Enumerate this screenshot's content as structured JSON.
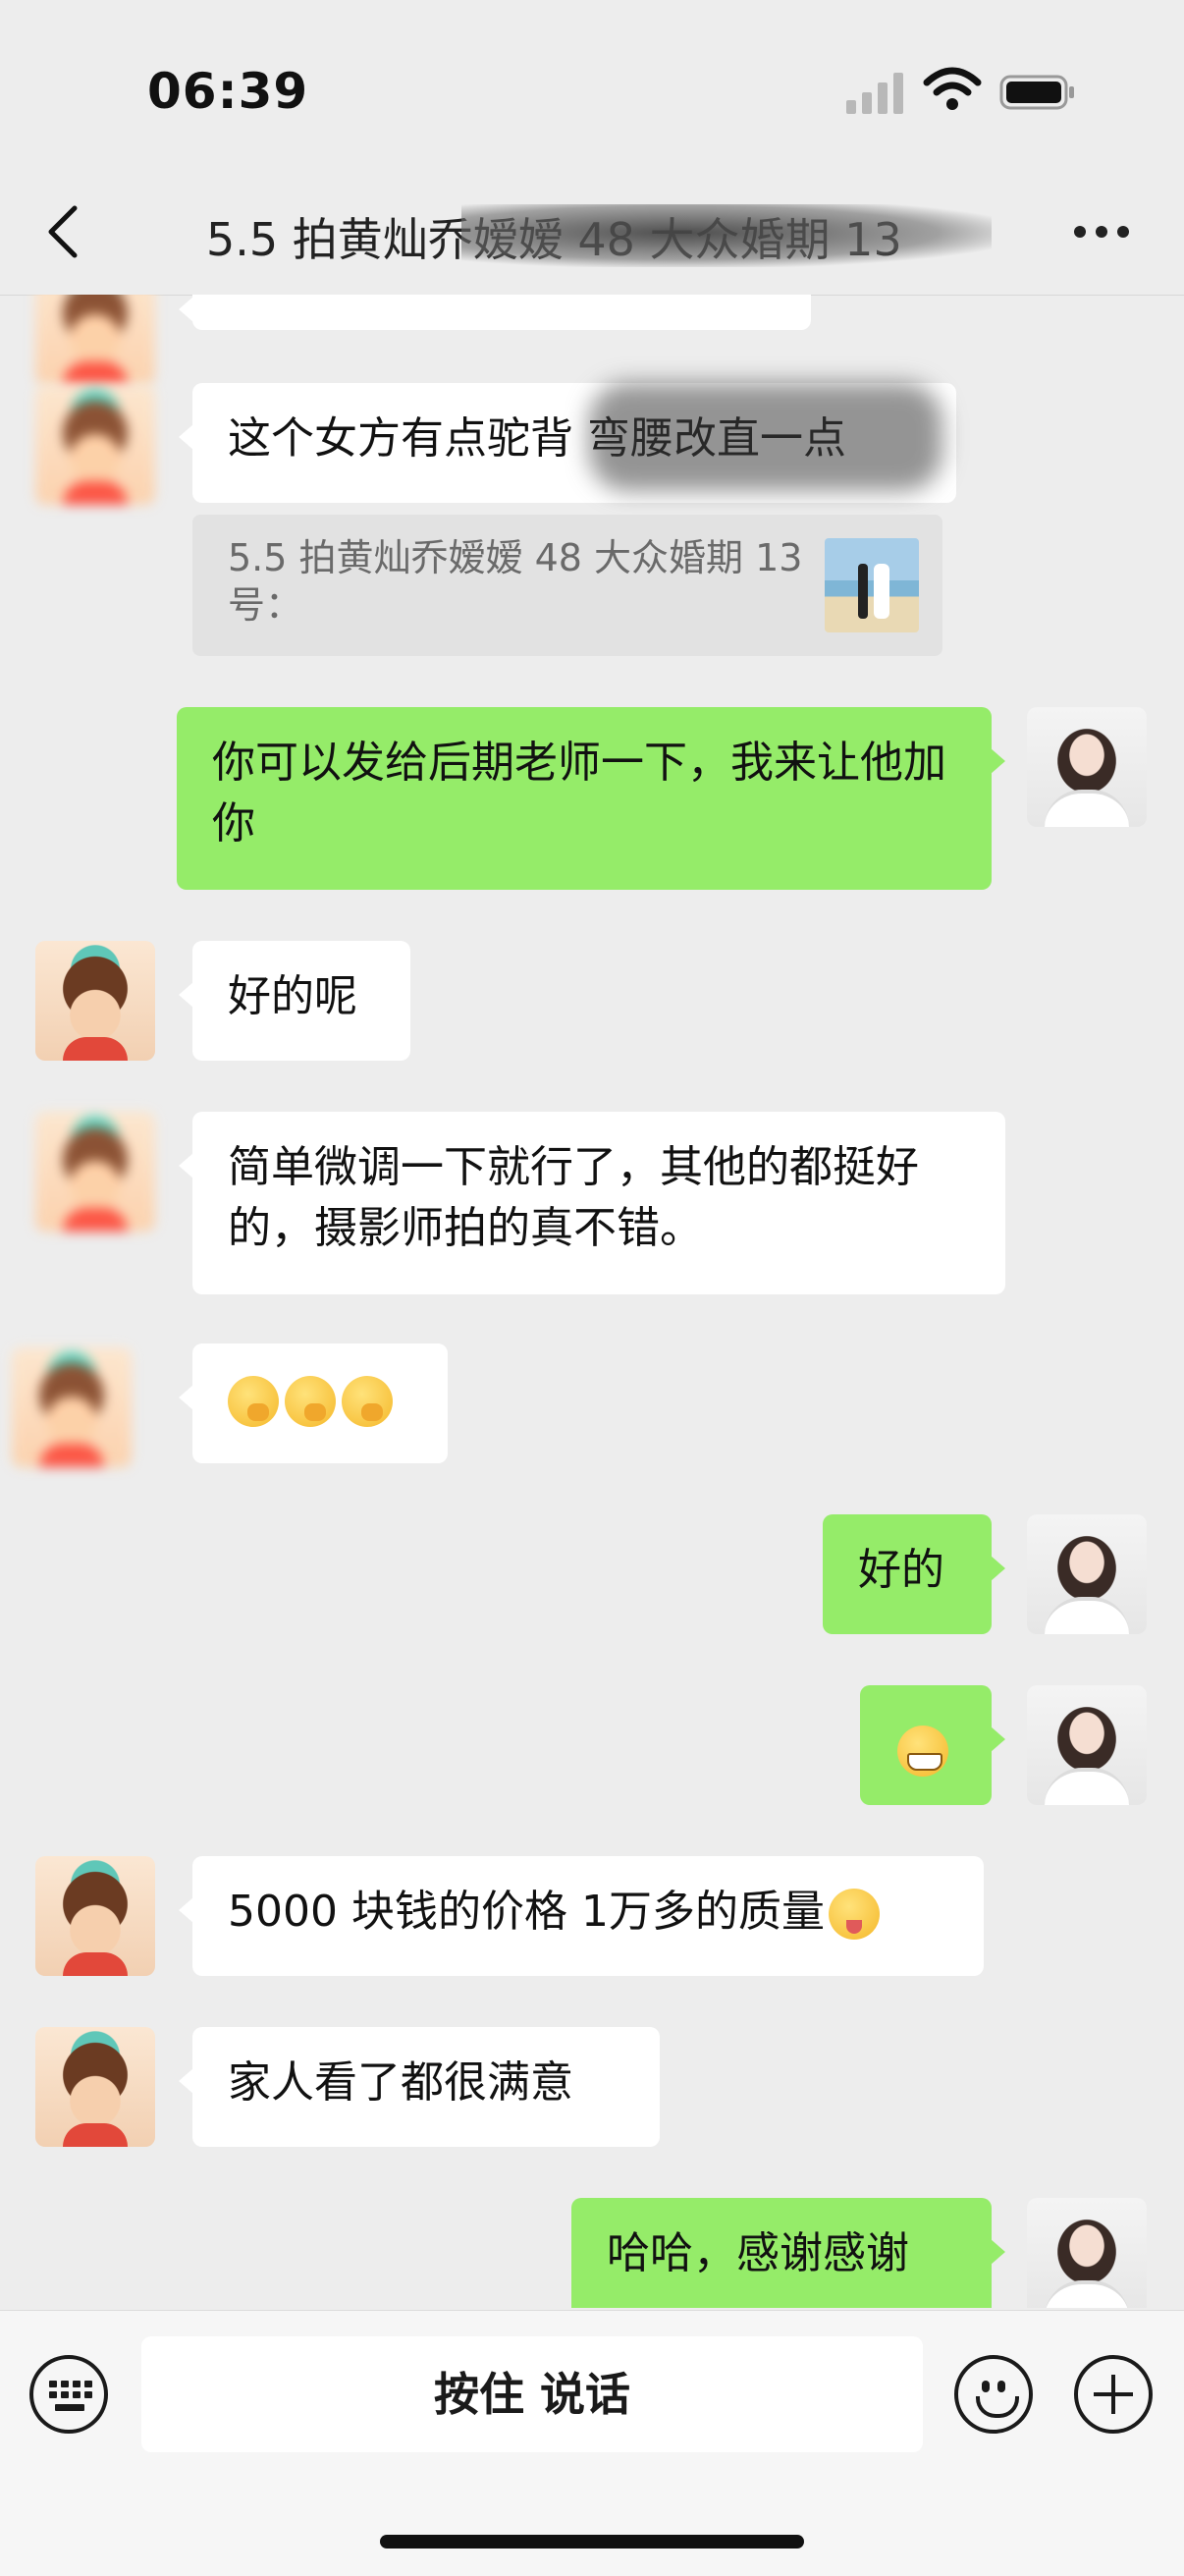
{
  "status": {
    "time": "06:39"
  },
  "nav": {
    "title": "5.5 拍黄灿乔嫒嫒 48 大众婚期 13"
  },
  "messages": [
    {
      "side": "in",
      "text": "这个女方有点驼背 弯腰改直一点"
    },
    {
      "side": "quote",
      "text": "5.5 拍黄灿乔嫒嫒 48 大众婚期 13号："
    },
    {
      "side": "out",
      "text": "你可以发给后期老师一下，我来让他加你"
    },
    {
      "side": "in",
      "text": "好的呢"
    },
    {
      "side": "in",
      "text": "简单微调一下就行了，其他的都挺好的，摄影师拍的真不错。"
    },
    {
      "side": "in",
      "text": "",
      "emoji": "hand-over-mouth-emoji x3"
    },
    {
      "side": "out",
      "text": "好的"
    },
    {
      "side": "out",
      "text": "",
      "emoji": "grinning-face-emoji"
    },
    {
      "side": "in",
      "text": "5000 块钱的价格 1万多的质量"
    },
    {
      "side": "in",
      "text": "家人看了都很满意"
    },
    {
      "side": "out",
      "text": "哈哈，感谢感谢"
    }
  ],
  "input": {
    "voice_label": "按住 说话"
  },
  "icons": {
    "back": "chevron-left-icon",
    "more": "more-dots-icon",
    "keyboard": "keyboard-icon",
    "emoji": "smiley-icon",
    "plus": "plus-icon"
  },
  "colors": {
    "background": "#ededed",
    "outgoing_bubble": "#95ec69",
    "incoming_bubble": "#ffffff"
  }
}
